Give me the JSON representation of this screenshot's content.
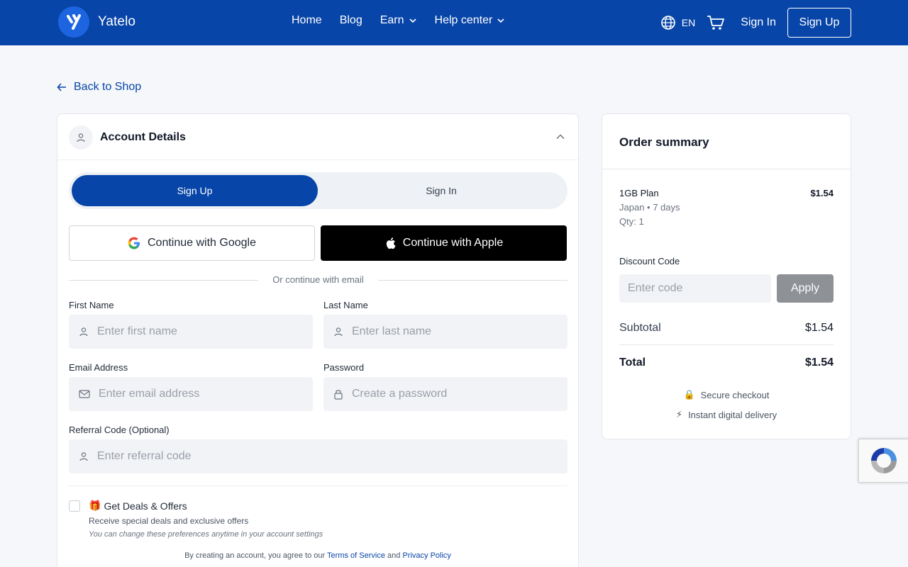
{
  "header": {
    "brand": "Yatelo",
    "nav": [
      {
        "label": "Home",
        "dropdown": false
      },
      {
        "label": "Blog",
        "dropdown": false
      },
      {
        "label": "Earn",
        "dropdown": true
      },
      {
        "label": "Help center",
        "dropdown": true
      }
    ],
    "language": "EN",
    "sign_in": "Sign In",
    "sign_up": "Sign Up"
  },
  "back_link": "Back to Shop",
  "account": {
    "title": "Account Details",
    "tabs": {
      "active": "Sign Up",
      "inactive": "Sign In"
    },
    "google_label": "Continue with Google",
    "apple_label": "Continue with Apple",
    "divider_text": "Or continue with email",
    "fields": {
      "first_name": {
        "label": "First Name",
        "placeholder": "Enter first name"
      },
      "last_name": {
        "label": "Last Name",
        "placeholder": "Enter last name"
      },
      "email": {
        "label": "Email Address",
        "placeholder": "Enter email address"
      },
      "password": {
        "label": "Password",
        "placeholder": "Create a password"
      },
      "referral": {
        "label": "Referral Code (Optional)",
        "placeholder": "Enter referral code"
      }
    },
    "deals": {
      "emoji": "🎁",
      "title": "Get Deals & Offers",
      "subtitle": "Receive special deals and exclusive offers",
      "note": "You can change these preferences anytime in your account settings"
    },
    "terms": {
      "prefix": "By creating an account, you agree to our",
      "tos": "Terms of Service",
      "and": "and",
      "privacy": "Privacy Policy"
    }
  },
  "order": {
    "title": "Order summary",
    "item": {
      "name": "1GB Plan",
      "price": "$1.54",
      "meta": "Japan • 7 days",
      "qty": "Qty: 1"
    },
    "discount_label": "Discount Code",
    "discount_placeholder": "Enter code",
    "apply_label": "Apply",
    "subtotal_label": "Subtotal",
    "subtotal_value": "$1.54",
    "total_label": "Total",
    "total_value": "$1.54",
    "trust": [
      {
        "icon": "🔒",
        "text": "Secure checkout"
      },
      {
        "icon": "⚡",
        "text": "Instant digital delivery"
      }
    ]
  },
  "colors": {
    "brand": "#0845a8",
    "apply_disabled": "#8e9196"
  }
}
